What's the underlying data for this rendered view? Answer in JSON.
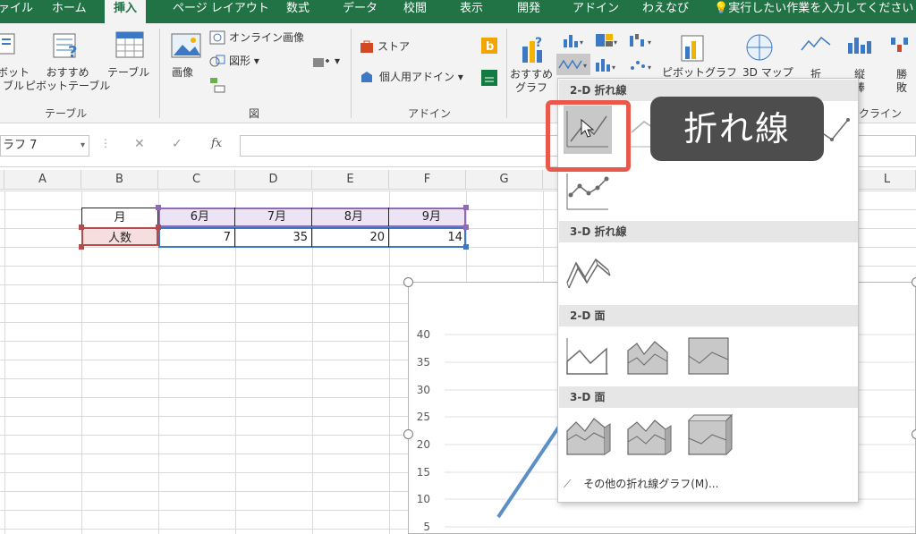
{
  "ribbon_tabs": [
    {
      "label": "ァイル"
    },
    {
      "label": "ホーム"
    },
    {
      "label": "挿入"
    },
    {
      "label": "ページ レイアウト"
    },
    {
      "label": "数式"
    },
    {
      "label": "データ"
    },
    {
      "label": "校閲"
    },
    {
      "label": "表示"
    },
    {
      "label": "開発"
    },
    {
      "label": "アドイン"
    },
    {
      "label": "わえなび"
    },
    {
      "label": "実行したい作業を入力してください"
    }
  ],
  "ribbon": {
    "pivot_partial_1": "ボット",
    "pivot_partial_2": "ブル",
    "recommended_pivot_1": "おすすめ",
    "recommended_pivot_2": "ピボットテーブル",
    "table": "テーブル",
    "image": "画像",
    "online_image": "オンライン画像",
    "shapes": "図形",
    "store": "ストア",
    "personal_addins": "個人用アドイン",
    "recommended_chart_1": "おすすめ",
    "recommended_chart_2": "グラフ",
    "pivot_chart": "ピボットグラフ",
    "map_3d": "3D マップ",
    "line_sparkline": "折",
    "column_sparkline_1": "縦",
    "column_sparkline_2": "棒",
    "winloss_1": "勝",
    "winloss_2": "敗",
    "group_table": "テーブル",
    "group_illustrations": "図",
    "group_addins": "アドイン",
    "group_sparklines": "クライン"
  },
  "formula_bar": {
    "name_box": "ラフ 7",
    "cancel": "✕",
    "enter": "✓",
    "fx": "fx"
  },
  "columns": [
    "A",
    "B",
    "C",
    "D",
    "E",
    "F",
    "G",
    "L"
  ],
  "table": {
    "header_label": "月",
    "row_label": "人数",
    "months": [
      "6月",
      "7月",
      "8月",
      "9月"
    ],
    "values": [
      "7",
      "35",
      "20",
      "14"
    ]
  },
  "chart": {
    "y_ticks": [
      "40",
      "35",
      "30",
      "25",
      "20",
      "15",
      "10",
      "5"
    ],
    "line_color": "#5b8fc7"
  },
  "dropdown": {
    "sec_2d_line": "2-D 折れ線",
    "sec_3d_line": "3-D 折れ線",
    "sec_2d_area": "2-D 面",
    "sec_3d_area": "3-D 面",
    "more_link": "その他の折れ線グラフ(M)..."
  },
  "tooltip": "折れ線",
  "accent": "#217346",
  "highlight": "#e8594b"
}
